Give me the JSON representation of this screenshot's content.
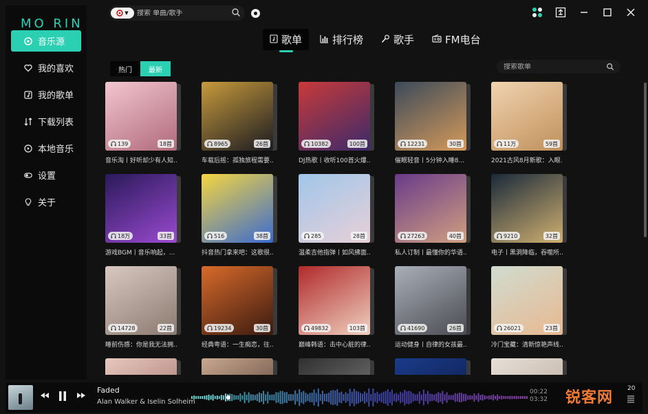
{
  "app": {
    "logo": "MO RIN"
  },
  "colors": {
    "accent": "#2bd0b3",
    "background": "#121212",
    "sidebar": "#0b0b0b",
    "watermark": "#f17a34"
  },
  "sidebar": {
    "items": [
      {
        "label": "音乐源",
        "icon": "disc-icon",
        "active": true
      },
      {
        "label": "我的喜欢",
        "icon": "heart-icon"
      },
      {
        "label": "我的歌单",
        "icon": "playlist-icon"
      },
      {
        "label": "下载列表",
        "icon": "download-icon"
      },
      {
        "label": "本地音乐",
        "icon": "play-circle-icon"
      },
      {
        "label": "设置",
        "icon": "toggle-icon"
      },
      {
        "label": "关于",
        "icon": "bulb-icon"
      }
    ]
  },
  "topbar": {
    "search_placeholder": "搜索 单曲/歌手"
  },
  "tabs": [
    {
      "label": "歌单",
      "icon": "playlist-icon",
      "active": true
    },
    {
      "label": "排行榜",
      "icon": "bar-chart-icon"
    },
    {
      "label": "歌手",
      "icon": "singer-icon"
    },
    {
      "label": "FM电台",
      "icon": "radio-icon"
    }
  ],
  "filters": [
    {
      "label": "热门"
    },
    {
      "label": "最新",
      "active": true
    }
  ],
  "playlist_search": {
    "placeholder": "搜索歌单"
  },
  "cards": [
    {
      "title": "音乐淘丨好听却少有人知...",
      "plays": "139",
      "count": "18首",
      "c1": "#f2c6cf",
      "c2": "#b06a7a"
    },
    {
      "title": "车载后摇：孤独旅程需要...",
      "plays": "8965",
      "count": "26首",
      "c1": "#c79a3b",
      "c2": "#1b1b22"
    },
    {
      "title": "DJ热歌丨收听100首火爆...",
      "plays": "10382",
      "count": "100首",
      "c1": "#c83a3a",
      "c2": "#3b2a6a"
    },
    {
      "title": "催眠轻音丨5分钟入睡8...",
      "plays": "12231",
      "count": "30首",
      "c1": "#3b4a5a",
      "c2": "#d69a5a"
    },
    {
      "title": "2021古风8月新歌：入眼...",
      "plays": "11万",
      "count": "59首",
      "c1": "#f0d3b0",
      "c2": "#c0905a"
    },
    {
      "title": "游戏BGM丨音乐响起，...",
      "plays": "18万",
      "count": "33首",
      "c1": "#2a1a5a",
      "c2": "#9a4ad0"
    },
    {
      "title": "抖音热门拿来吧：这歌很...",
      "plays": "516",
      "count": "38首",
      "c1": "#f5d640",
      "c2": "#3a6ad0"
    },
    {
      "title": "温柔吉他指弹丨如风拂面...",
      "plays": "285",
      "count": "28首",
      "c1": "#a0c6ea",
      "c2": "#e8d0d8"
    },
    {
      "title": "私人订制丨最懂你的华语...",
      "plays": "27263",
      "count": "40首",
      "c1": "#6a3a8a",
      "c2": "#d0a080"
    },
    {
      "title": "电子丨黑洞降临，吞噬所...",
      "plays": "9210",
      "count": "32首",
      "c1": "#1a2a3a",
      "c2": "#d0b070"
    },
    {
      "title": "睡前伤感：你是我无法拥...",
      "plays": "14728",
      "count": "22首",
      "c1": "#d8c8c0",
      "c2": "#8a7a70"
    },
    {
      "title": "经典粤语：一生痴恋，往...",
      "plays": "19234",
      "count": "30首",
      "c1": "#d86a2a",
      "c2": "#3a1a10"
    },
    {
      "title": "巅峰韩语：击中心脏的律...",
      "plays": "49832",
      "count": "103首",
      "c1": "#b02a2a",
      "c2": "#f0d0c0"
    },
    {
      "title": "运动健身丨自律的女孩最...",
      "plays": "41690",
      "count": "26首",
      "c1": "#aab0b8",
      "c2": "#4a4a52"
    },
    {
      "title": "冷门宝藏：清新惊艳声线...",
      "plays": "26021",
      "count": "23首",
      "c1": "#d0dcd0",
      "c2": "#e8b890"
    }
  ],
  "partial_row": [
    {
      "c1": "#e8c8c0",
      "c2": "#9a6a60"
    },
    {
      "c1": "#c8a890",
      "c2": "#4a3028"
    },
    {
      "c1": "#303030",
      "c2": "#8a8a8a"
    },
    {
      "c1": "#1a3a8a",
      "c2": "#0a1a40"
    },
    {
      "c1": "#e8e0d8",
      "c2": "#b0a090"
    }
  ],
  "player": {
    "song": "Faded",
    "artist": "Alan Walker & Iselin Solheim",
    "current_time": "00:22",
    "total_time": "03:32",
    "progress": 0.11,
    "volume": "20",
    "watermark": "锐客网"
  }
}
